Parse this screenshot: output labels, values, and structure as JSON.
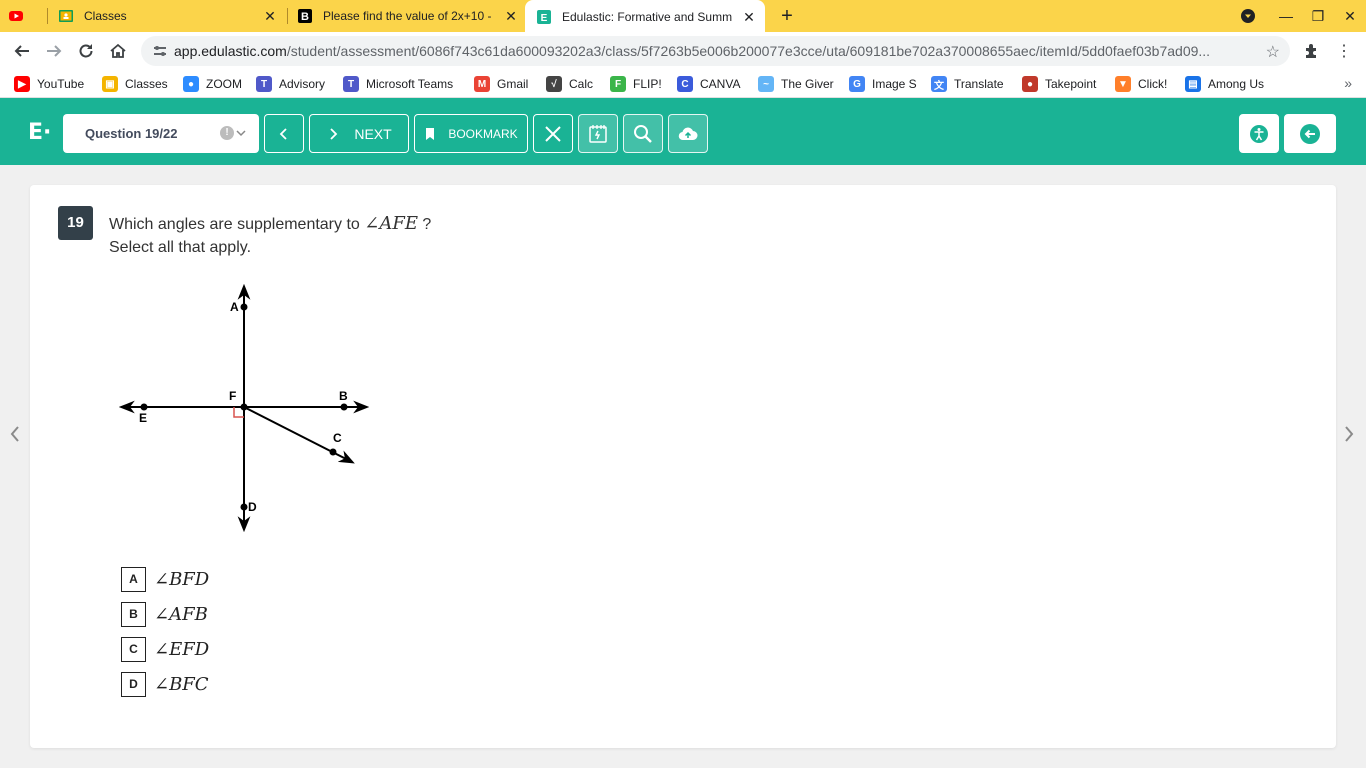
{
  "browser": {
    "tabs": [
      {
        "title": "",
        "favicon": "youtube-icon"
      },
      {
        "title": "Classes",
        "favicon": "google-classroom-icon"
      },
      {
        "title": "Please find the value of 2x+10 - B",
        "favicon": "brainly-icon"
      },
      {
        "title": "Edulastic: Formative and Summ",
        "favicon": "edulastic-icon",
        "active": true
      }
    ],
    "url_host": "app.edulastic.com",
    "url_path": "/student/assessment/6086f743c61da600093202a3/class/5f7263b5e006b200077e3cce/uta/609181be702a370008655aec/itemId/5dd0faef03b7ad09...",
    "bookmarks": [
      {
        "label": "YouTube",
        "icon": "youtube-icon",
        "color": "#ff0000"
      },
      {
        "label": "Classes",
        "icon": "google-classroom-icon",
        "color": "#f4b400"
      },
      {
        "label": "ZOOM",
        "icon": "zoom-icon",
        "color": "#2d8cff"
      },
      {
        "label": "Advisory",
        "icon": "teams-icon",
        "color": "#5059c9"
      },
      {
        "label": "Microsoft Teams",
        "icon": "teams-icon",
        "color": "#5059c9"
      },
      {
        "label": "Gmail",
        "icon": "gmail-icon",
        "color": "#ea4335"
      },
      {
        "label": "Calc",
        "icon": "calc-icon",
        "color": "#444444"
      },
      {
        "label": "FLIP!",
        "icon": "flip-icon",
        "color": "#3bb54a"
      },
      {
        "label": "CANVA",
        "icon": "canva-icon",
        "color": "#3b5bdb"
      },
      {
        "label": "The Giver",
        "icon": "bookmark-icon",
        "color": "#64b5f6"
      },
      {
        "label": "Image S",
        "icon": "google-icon",
        "color": "#4285f4"
      },
      {
        "label": "Translate",
        "icon": "translate-icon",
        "color": "#4285f4"
      },
      {
        "label": "Takepoint",
        "icon": "takepoint-icon",
        "color": "#c0392b"
      },
      {
        "label": "Click!",
        "icon": "fox-icon",
        "color": "#ff7f2a"
      },
      {
        "label": "Among Us",
        "icon": "page-icon",
        "color": "#1a73e8"
      }
    ]
  },
  "header": {
    "question_selector": "Question 19/22",
    "next_label": "NEXT",
    "bookmark_label": "BOOKMARK",
    "accent": "#1ab395"
  },
  "question": {
    "number": "19",
    "stem_prefix": "Which angles are supplementary to",
    "stem_math": "∠AFE",
    "stem_suffix": "?",
    "instruction": "Select all that apply.",
    "points": {
      "A": "A",
      "B": "B",
      "C": "C",
      "D": "D",
      "E": "E",
      "F": "F"
    },
    "options": [
      {
        "letter": "A",
        "text": "∠BFD"
      },
      {
        "letter": "B",
        "text": "∠AFB"
      },
      {
        "letter": "C",
        "text": "∠EFD"
      },
      {
        "letter": "D",
        "text": "∠BFC"
      }
    ]
  }
}
